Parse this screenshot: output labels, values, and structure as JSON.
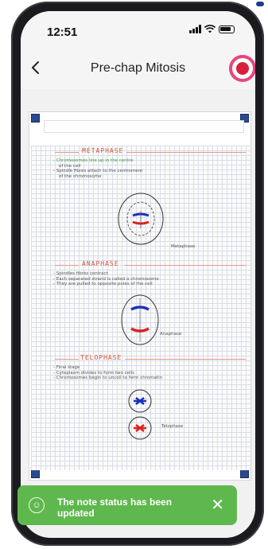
{
  "status_bar": {
    "time": "12:51"
  },
  "nav": {
    "title": "Pre-chap Mitosis"
  },
  "document": {
    "sections": [
      {
        "heading": "METAPHASE",
        "notes": [
          "- Chromosomes line up in the centre",
          "    of the cell",
          "- Spindle fibres attach to the centromere",
          "    of the chromosome"
        ],
        "label": "Metaphase"
      },
      {
        "heading": "ANAPHASE",
        "notes": [
          "- Spindles fibres contract",
          "- Each separated strand is called a chromosome",
          "- They are pulled to opposite poles of the cell"
        ],
        "label": "Anaphase"
      },
      {
        "heading": "TELOPHASE",
        "notes": [
          "- Final stage",
          "- Cytoplasm divides to form two cells",
          "- Chromosomes begin to uncoil to form chromatin"
        ],
        "label": "Telophase"
      }
    ]
  },
  "toast": {
    "message": "The note status has been updated"
  },
  "colors": {
    "accent": "#e8457a",
    "record": "#d8203c",
    "toast_bg": "#5fb84e",
    "heading": "#d4583b"
  }
}
